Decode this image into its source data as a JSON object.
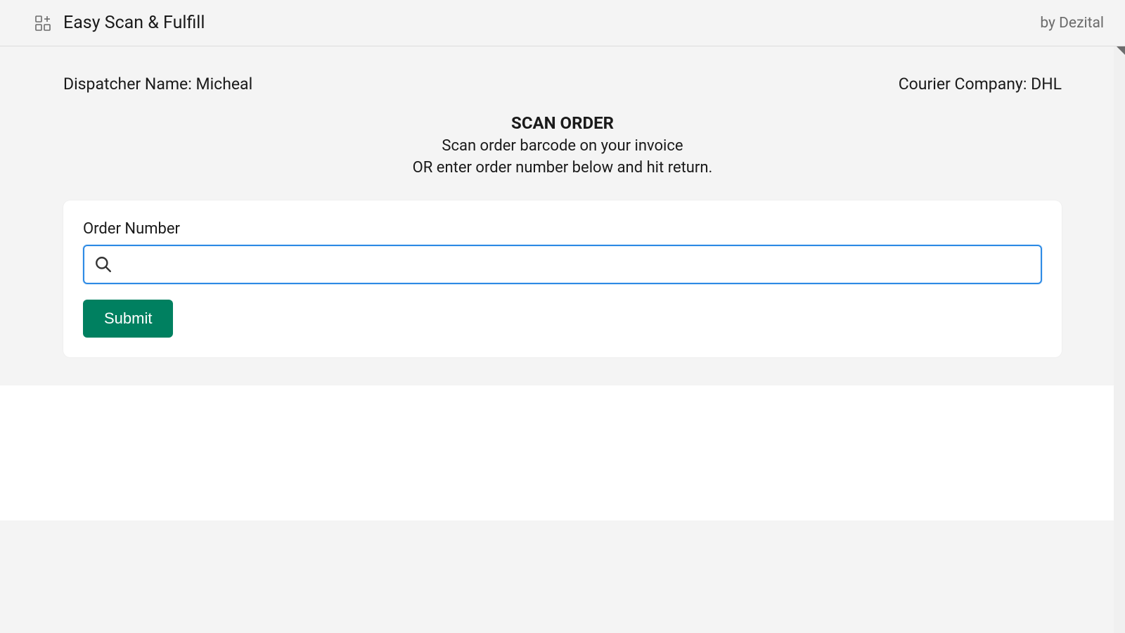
{
  "header": {
    "app_title": "Easy Scan & Fulfill",
    "brand": "by Dezital"
  },
  "info": {
    "dispatcher_label": "Dispatcher Name:",
    "dispatcher_value": "Micheal",
    "courier_label": "Courier Company:",
    "courier_value": "DHL"
  },
  "scan": {
    "title": "SCAN ORDER",
    "line1": "Scan order barcode on your invoice",
    "line2": "OR enter order number below and hit return."
  },
  "form": {
    "order_label": "Order Number",
    "order_value": "",
    "order_placeholder": "",
    "submit_label": "Submit"
  },
  "colors": {
    "accent_green": "#008060",
    "focus_blue": "#2d8ae5"
  }
}
